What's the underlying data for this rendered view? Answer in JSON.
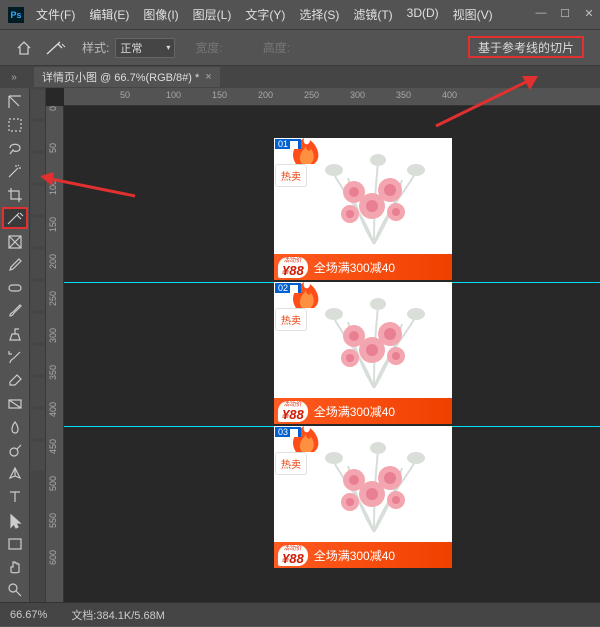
{
  "app_short": "Ps",
  "menus": [
    "文件(F)",
    "编辑(E)",
    "图像(I)",
    "图层(L)",
    "文字(Y)",
    "选择(S)",
    "滤镜(T)",
    "3D(D)",
    "视图(V)"
  ],
  "options": {
    "style_label": "样式:",
    "style_value": "正常",
    "width_label": "宽度:",
    "height_label": "高度:",
    "slice_from_guides": "基于参考线的切片"
  },
  "tab": {
    "title": "详情页小图 @ 66.7%(RGB/8#) *"
  },
  "ruler_h": [
    50,
    100,
    150,
    200,
    250,
    300,
    350,
    400
  ],
  "ruler_v": [
    0,
    50,
    100,
    150,
    200,
    250,
    300,
    350,
    400,
    450,
    500,
    550,
    600
  ],
  "slices": [
    {
      "badge": "01",
      "tag": "热卖",
      "price_label": "活动价",
      "price": "88",
      "promo": "全场满300减40"
    },
    {
      "badge": "02",
      "tag": "热卖",
      "price_label": "活动价",
      "price": "88",
      "promo": "全场满300减40"
    },
    {
      "badge": "03",
      "tag": "热卖",
      "price_label": "活动价",
      "price": "88",
      "promo": "全场满300减40"
    }
  ],
  "status": {
    "zoom": "66.67%",
    "doc_label": "文档:",
    "doc_value": "384.1K/5.68M"
  }
}
